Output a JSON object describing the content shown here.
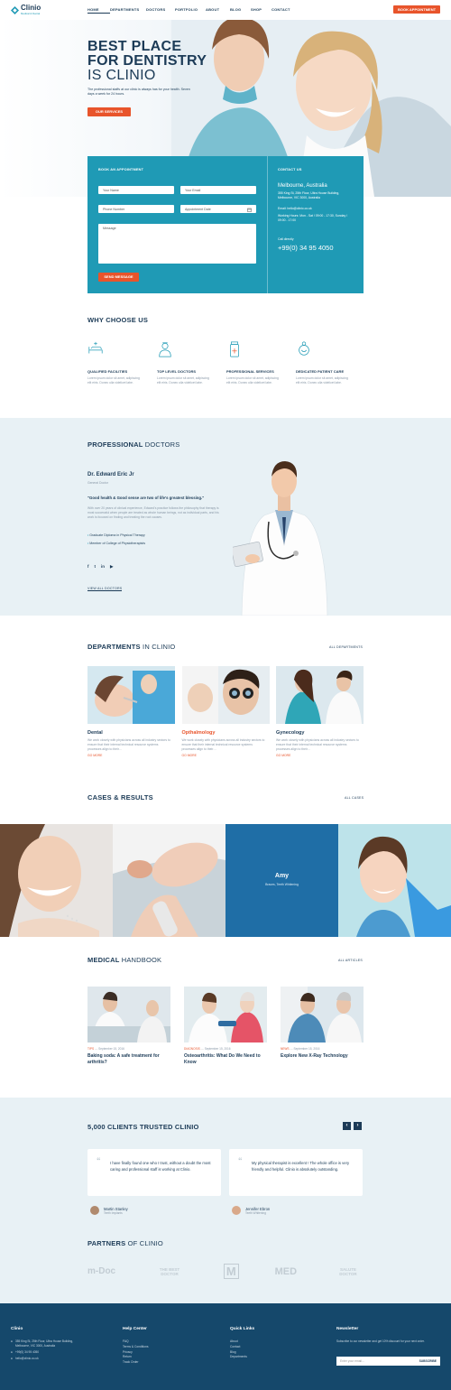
{
  "header": {
    "logo_name": "Clinio",
    "logo_tagline": "Medical & Dental",
    "nav": [
      "HOME",
      "DEPARTMENTS",
      "DOCTORS",
      "PORTFOLIO",
      "ABOUT",
      "BLOG",
      "SHOP",
      "CONTACT"
    ],
    "cta": "BOOK APPOINTMENT"
  },
  "hero": {
    "line1": "BEST PLACE",
    "line2": "FOR DENTISTRY",
    "line3": "IS CLINIO",
    "text": "The professional staffs at our clinic is always has for your health. Seven days a week for 24 hours.",
    "button": "OUR SERVICES"
  },
  "booking": {
    "title": "BOOK AN APPOINTMENT",
    "name_ph": "Your Name",
    "email_ph": "Your Email",
    "phone_ph": "Phone Number",
    "date_ph": "Appointment Date",
    "message_ph": "Message",
    "submit": "SEND MESSAGE",
    "contact_title": "CONTACT US",
    "city": "Melbourne, Australia",
    "address": "355 King St, 25th Floor, Ultra House Building, Melbourne, VIC 3000, Australia",
    "email": "Email: hello@clinio.co.uk",
    "hours": "Working Hours: Mon - Sat / 09:00 - 17:30, Sunday / 09:00 - 17:00",
    "call_label": "Call directly",
    "phone": "+99(0) 34 95 4050"
  },
  "why": {
    "title": "WHY CHOOSE US",
    "items": [
      {
        "icon": "bed-icon",
        "title": "QUALIFIED FACILITIES",
        "text": "Lorem ipsum dolor sit amet, adipiscing elit eiris. Donec ulla videlicet labe."
      },
      {
        "icon": "doctor-icon",
        "title": "TOP LEVEL DOCTORS",
        "text": "Lorem ipsum dolor sit amet, adipiscing elit eiris. Donec ulla videlicet labe."
      },
      {
        "icon": "medicine-icon",
        "title": "PROFESSIONAL SERVICES",
        "text": "Lorem ipsum dolor sit amet, adipiscing elit eiris. Donec ulla videlicet labe."
      },
      {
        "icon": "patient-care-icon",
        "title": "DEDICATED PATIENT CARE",
        "text": "Lorem ipsum dolor sit amet, adipiscing elit eiris. Donec ulla videlicet labe."
      }
    ]
  },
  "doctors": {
    "title_bold": "PROFESSIONAL",
    "title_thin": "DOCTORS",
    "name": "Dr. Edward Eric Jr",
    "role": "General Doctor",
    "quote": "\"Good health & Good sense are two of life's greatest blessing.\"",
    "bio": "With over 20 years of clinical experience, Edward's practice follows the philosophy that therapy is most successful when people are treated as whole human beings, not as individual parts, and his work is focused on finding and treating the root causes.",
    "credentials": [
      "Graduate Diploma in Physical Therapy",
      "Member of College of Physiotherapists"
    ],
    "view_all": "VIEW ALL DOCTORS"
  },
  "departments": {
    "title_bold": "DEPARTMENTS",
    "title_thin": "IN CLINIO",
    "all_link": "ALL DEPARTMENTS",
    "items": [
      {
        "name": "Dental",
        "text": "We work closely with physicians across all industry sectors to ensure that their internal technical resource systems processes align to their…",
        "more": "GO MORE"
      },
      {
        "name": "Opthalmology",
        "text": "We work closely with physicians across all industry sectors to ensure that their internal technical resource systems processes align to their…",
        "more": "GO MORE"
      },
      {
        "name": "Gynecology",
        "text": "We work closely with physicians across all industry sectors to ensure that their internal technical resource systems processes align to their…",
        "more": "GO MORE"
      }
    ]
  },
  "cases": {
    "title": "CASES & RESULTS",
    "all_link": "ALL CASES",
    "featured_name": "Amy",
    "featured_sub": "Braces, Teeth Whitening"
  },
  "handbook": {
    "title_bold": "MEDICAL",
    "title_thin": "HANDBOOK",
    "all_link": "ALL ARTICLES",
    "articles": [
      {
        "cat": "TIPS",
        "date": "September 15, 2016",
        "title": "Baking soda: A safe treatment for arthritis?"
      },
      {
        "cat": "DIAGNOSIS",
        "date": "September 15, 2016",
        "title": "Osteoarthritis: What Do We Need to Know"
      },
      {
        "cat": "NEWS",
        "date": "September 15, 2016",
        "title": "Explore New X-Ray Technology"
      }
    ]
  },
  "testimonials": {
    "title": "5,000 CLIENTS TRUSTED CLINIO",
    "items": [
      {
        "text": "I have finally found one who I trust, without a doubt the most caring and professional staff is working at Clinio.",
        "name": "Martin Stanley",
        "role": "Teeth Implants"
      },
      {
        "text": "My physical therapist is excellent ! The whole office is very friendly and helpful. Clinio is absolutely outstanding.",
        "name": "Jennifer Ebron",
        "role": "Teeth Whitening"
      }
    ]
  },
  "partners": {
    "title_bold": "PARTNERS",
    "title_thin": "OF CLINIO",
    "logos": [
      "m-Doc",
      "THE BEST DOCTOR",
      "M",
      "MED",
      "SALUTE DOCTOR"
    ]
  },
  "footer": {
    "brand": "Clinio",
    "address": "355 King St, 25th Floor, Ultra House Building, Melbourne, VIC 3000, Australia",
    "phone": "+99(0) 34 95 4050",
    "email": "hello@clinio.co.uk",
    "help_title": "Help Center",
    "help_links": [
      "FAQ",
      "Terms & Conditions",
      "Privacy",
      "Return",
      "Track Order"
    ],
    "quick_title": "Quick Links",
    "quick_links": [
      "About",
      "Contact",
      "Blog",
      "Departments"
    ],
    "news_title": "Newsletter",
    "news_text": "Subscribe to our newsletter and get 10% discount for your next order.",
    "news_ph": "Enter your email...",
    "news_button": "SUBSCRIBE"
  },
  "colors": {
    "accent": "#e8542b",
    "teal": "#1f9ab5",
    "navy": "#1c3b57",
    "footer": "#15486b"
  }
}
